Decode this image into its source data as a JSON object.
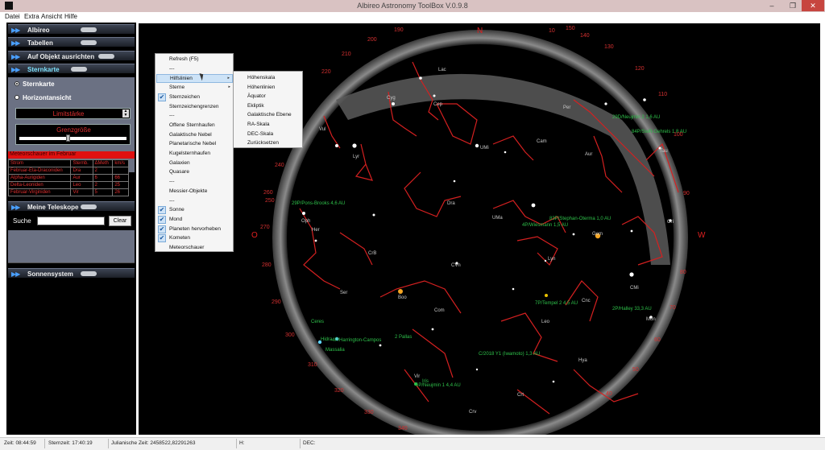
{
  "window": {
    "title": "Albireo Astronomy ToolBox V.0.9.8",
    "min": "‒",
    "max": "❐",
    "close": "✕"
  },
  "menubar": [
    "Datei",
    "Extra",
    "Ansicht",
    "Hilfe"
  ],
  "left_panel": {
    "sections": [
      {
        "label": "Albireo"
      },
      {
        "label": "Tabellen"
      },
      {
        "label": "Auf Objekt ausrichten"
      },
      {
        "label": "Sternkarte"
      }
    ],
    "sternkarte": {
      "radio_sternkarte": "Sternkarte",
      "radio_horizont": "Horizontansicht",
      "limit_label": "Limitstärke",
      "grenz_label": "Grenzgröße"
    },
    "meteor": {
      "header": "Meteorschauer im Februar",
      "columns": [
        "Strom",
        "Sternb.",
        "ΔMeth",
        "km/s"
      ],
      "rows": [
        [
          "Februar-Eta-Draconiden",
          "Dra",
          "2",
          ""
        ],
        [
          "Alpha-Aurigiden",
          "Aur",
          "6",
          "66"
        ],
        [
          "Delta-Leoniden",
          "Leo",
          "2",
          "25"
        ],
        [
          "Februar-Virginiden",
          "Vir",
          "5",
          "26"
        ]
      ]
    },
    "teleskope_label": "Meine Teleskope",
    "suche_label": "Suche",
    "clear_label": "Clear",
    "sonnensystem_label": "Sonnensystem"
  },
  "context_menu": {
    "items": [
      {
        "label": "Refresh (F5)",
        "checked": false
      },
      {
        "label": "---",
        "checked": false
      },
      {
        "label": "Hilfslinien",
        "checked": false,
        "submenu": true,
        "highlight": true
      },
      {
        "label": "Sterne",
        "checked": false,
        "submenu": true
      },
      {
        "label": "Sternzeichen",
        "checked": true
      },
      {
        "label": "Sternzeichengrenzen",
        "checked": false
      },
      {
        "label": "---",
        "checked": false
      },
      {
        "label": "Offene Sternhaufen",
        "checked": false
      },
      {
        "label": "Galaktische Nebel",
        "checked": false
      },
      {
        "label": "Planetarische Nebel",
        "checked": false
      },
      {
        "label": "Kugelsternhaufen",
        "checked": false
      },
      {
        "label": "Galaxien",
        "checked": false
      },
      {
        "label": "Quasare",
        "checked": false
      },
      {
        "label": "---",
        "checked": false
      },
      {
        "label": "Messier-Objekte",
        "checked": false
      },
      {
        "label": "---",
        "checked": false
      },
      {
        "label": "Sonne",
        "checked": true
      },
      {
        "label": "Mond",
        "checked": true
      },
      {
        "label": "Planeten hervorheben",
        "checked": true
      },
      {
        "label": "Kometen",
        "checked": true
      },
      {
        "label": "Meteorschauer",
        "checked": false
      }
    ],
    "check_glyph": "✔",
    "arrow_glyph": "▸",
    "submenu": [
      "Höhenskala",
      "Höhenlinien",
      "Äquator",
      "Ekliptik",
      "Galaktische Ebene",
      "RA-Skala",
      "DEC-Skala",
      "Zurücksetzen"
    ]
  },
  "sky": {
    "cardinals": {
      "north": "N",
      "west": "W",
      "east": "O"
    },
    "azimuth_ticks": [
      "10",
      "120",
      "130",
      "140",
      "150",
      "190",
      "200",
      "210",
      "220",
      "230",
      "240",
      "250",
      "260",
      "270",
      "280",
      "290",
      "300",
      "310",
      "320",
      "330",
      "340",
      "90",
      "80",
      "70",
      "60",
      "50",
      "40",
      "110",
      "100"
    ],
    "constellations": [
      "Lac",
      "Cyg",
      "Cep",
      "Vul",
      "Lyr",
      "Dra",
      "UMi",
      "Cam",
      "Per",
      "Aur",
      "Tau",
      "Ori",
      "Gem",
      "UMa",
      "Lyn",
      "CMi",
      "Cnc",
      "Leo",
      "Mon",
      "Oph",
      "Her",
      "CrB",
      "Ser",
      "Boo",
      "CVn",
      "Com",
      "Vir",
      "Hya",
      "Crt",
      "Crv"
    ],
    "comets": [
      "29D/Neujmin 2 1,6 AU",
      "84P/Swift-Gehrels 1,8 AU",
      "29P/Pons-Brooks 4,6 AU",
      "83P/Stephan-Oterma 1,0 AU",
      "4P/Wiesmann 1,5 AU",
      "7P/Tempel 2 4,5 AU",
      "2P/Halley 33,3 AU",
      "4P/Harrington-Campos",
      "2 Pallas",
      "C/2018 Y1 (Iwamoto) 1,3 AU",
      "Ceres",
      "Hidra",
      "Massalia",
      "Iris",
      "6P/Neujmin 1 4,4 AU"
    ]
  },
  "status": {
    "zeit": "Zeit: 08:44:59",
    "sternzeit": "Sternzeit: 17:40:19",
    "julian": "Julianische Zeit: 2458522,82291263",
    "h": "H:",
    "dec": "DEC:"
  }
}
